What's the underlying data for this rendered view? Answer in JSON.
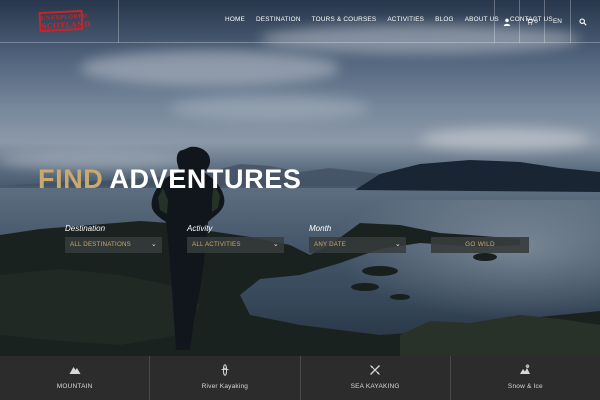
{
  "brand": {
    "line1": "UNEXPLORED",
    "line2": "SCOTLAND"
  },
  "nav": [
    {
      "label": "HOME"
    },
    {
      "label": "DESTINATION"
    },
    {
      "label": "TOURS & COURSES"
    },
    {
      "label": "ACTIVITIES"
    },
    {
      "label": "BLOG"
    },
    {
      "label": "ABOUT US"
    },
    {
      "label": "CONTACT US"
    }
  ],
  "utility": {
    "cart_count": "0",
    "language": "EN",
    "icons": [
      "user-icon",
      "cart-icon",
      "search-icon"
    ]
  },
  "hero": {
    "headline_accent": "FIND",
    "headline_main": "ADVENTURES"
  },
  "search": {
    "destination_label": "Destination",
    "destination_value": "ALL DESTINATIONS",
    "activity_label": "Activity",
    "activity_value": "ALL ACTIVITIES",
    "month_label": "Month",
    "month_value": "ANY DATE",
    "submit_label": "GO WILD"
  },
  "categories": [
    {
      "label": "MOUNTAIN",
      "icon": "mountain-icon"
    },
    {
      "label": "River Kayaking",
      "icon": "river-kayak-icon"
    },
    {
      "label": "SEA KAYAKING",
      "icon": "sea-kayak-icon"
    },
    {
      "label": "Snow & Ice",
      "icon": "snow-ice-icon"
    }
  ],
  "colors": {
    "accent": "#c9a96e",
    "brand_red": "#c8242a",
    "category_bar": "#2c2c2c"
  }
}
